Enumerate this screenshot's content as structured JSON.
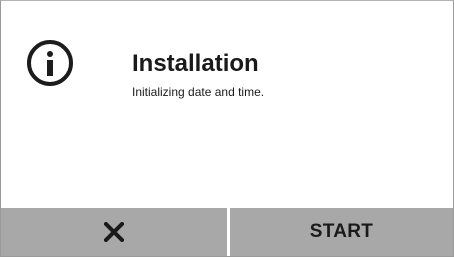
{
  "dialog": {
    "icon": "info-icon",
    "title": "Installation",
    "message": "Initializing date and time."
  },
  "buttons": {
    "cancel_icon": "close-icon",
    "start_label": "START"
  },
  "colors": {
    "background": "#ffffff",
    "button_background": "#a8a8a8",
    "text": "#1a1a1a"
  }
}
